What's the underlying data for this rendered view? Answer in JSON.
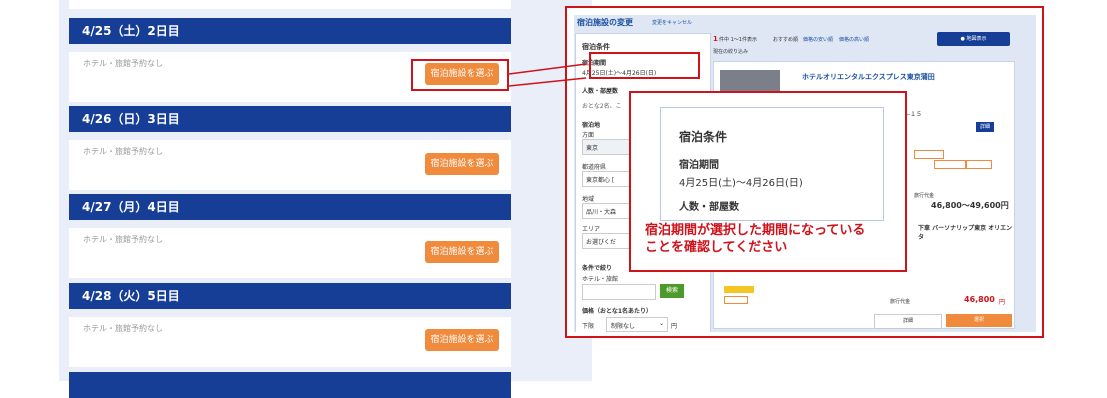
{
  "days": [
    {
      "header": "4/25（土）2日目",
      "note": "ホテル・旅館予約なし",
      "button": "宿泊施設を選ぶ"
    },
    {
      "header": "4/26（日）3日目",
      "note": "ホテル・旅館予約なし",
      "button": "宿泊施設を選ぶ"
    },
    {
      "header": "4/27（月）4日目",
      "note": "ホテル・旅館予約なし",
      "button": "宿泊施設を選ぶ"
    },
    {
      "header": "4/28（火）5日目",
      "note": "ホテル・旅館予約なし",
      "button": "宿泊施設を選ぶ"
    }
  ],
  "change_panel": {
    "title": "宿泊施設の変更",
    "cancel_link": "変更をキャンセル",
    "count_num": "1",
    "count_text": "件中 1〜1件表示",
    "sort_recommended": "おすすめ順",
    "sort_price_low": "価格の安い順",
    "sort_price_high": "価格の高い順",
    "current_filter": "現在の絞り込み",
    "map_button": "地図表示",
    "conditions_title": "宿泊条件",
    "period_label": "宿泊期間",
    "period_value": "4月25日(土)〜4月26日(日)",
    "people_label": "人数・部屋数",
    "people_value": "おとな2名、こ",
    "lodging_label": "宿泊地",
    "direction_label": "方面",
    "direction_value": "東京",
    "prefecture_label": "都道府県",
    "prefecture_value": "東京都心 [",
    "area_label": "地域",
    "area_value": "品川・大森",
    "area2_label": "エリア",
    "area2_value": "お選びくだ",
    "narrow_label": "条件で絞り",
    "hotel_name_label": "ホテル・旅館",
    "search_button": "検索",
    "price_label": "価格（おとな1名あたり）",
    "price_min_label": "下限",
    "price_min_value": "制限なし",
    "yen": "円",
    "hotel_name": "ホテルオリエンタルエクスプレス東京蒲田",
    "hotel_address_fragment": "―１５",
    "detail_small_button": "詳細",
    "price_caption": "旅行代金",
    "price_range": "46,800〜49,600円",
    "second_hotel_fragment": "下車 バーソナリップ東京 オリエンタ",
    "price_final": "46,800",
    "price_final_unit": "円",
    "detail_button": "詳細",
    "select_button": "選択"
  },
  "popup": {
    "title": "宿泊条件",
    "period_label": "宿泊期間",
    "period_value": "4月25日(土)〜4月26日(日)",
    "people_label": "人数・部屋数"
  },
  "annotation": {
    "line1": "宿泊期間が選択した期間になっている",
    "line2": "ことを確認してください"
  },
  "colors": {
    "day_header": "#163e97",
    "orange_button": "#f08a3c",
    "highlight_red": "#d0121b",
    "link_blue": "#1a4fa0"
  }
}
